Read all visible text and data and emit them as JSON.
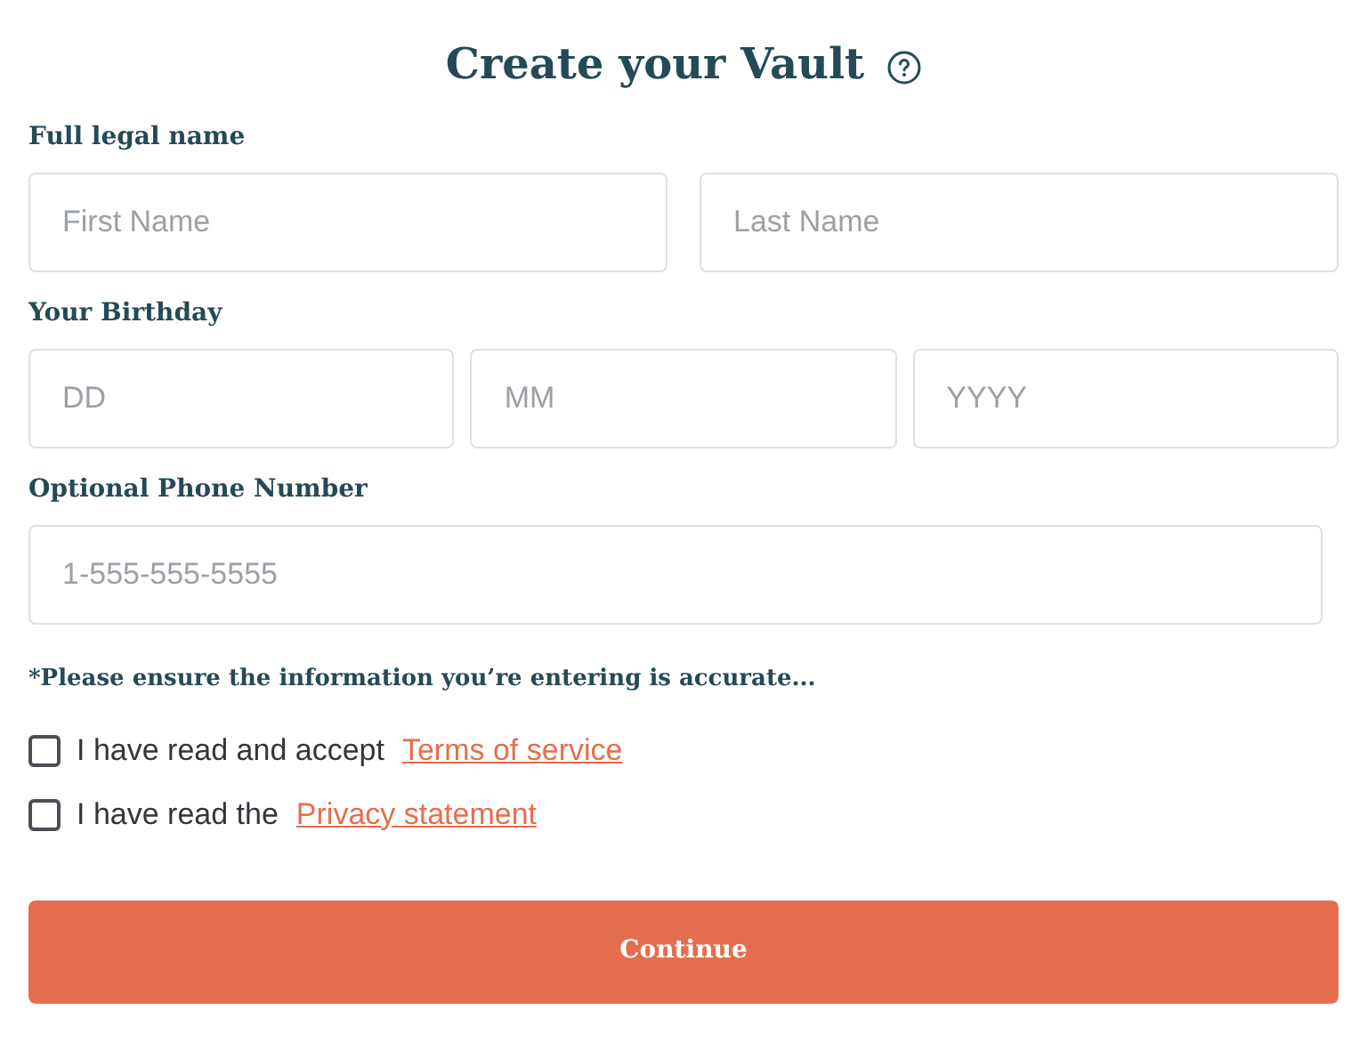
{
  "title": "Create your Vault",
  "sections": [
    {
      "label": "Full legal name",
      "fields": [
        {
          "placeholder": "First Name"
        },
        {
          "placeholder": "Last Name"
        }
      ]
    },
    {
      "label": "Your Birthday",
      "fields": [
        {
          "placeholder": "DD"
        },
        {
          "placeholder": "MM"
        },
        {
          "placeholder": "YYYY"
        }
      ]
    },
    {
      "label": "Optional Phone Number",
      "fields": [
        {
          "placeholder": "1-555-555-5555"
        }
      ]
    }
  ],
  "note": "*Please ensure the information you’re entering is accurate...",
  "agreements": [
    {
      "text": "I have read and accept",
      "link": "Terms of service",
      "checked": false
    },
    {
      "text": "I have read the",
      "link": "Privacy statement",
      "checked": false
    }
  ],
  "button": "Continue"
}
